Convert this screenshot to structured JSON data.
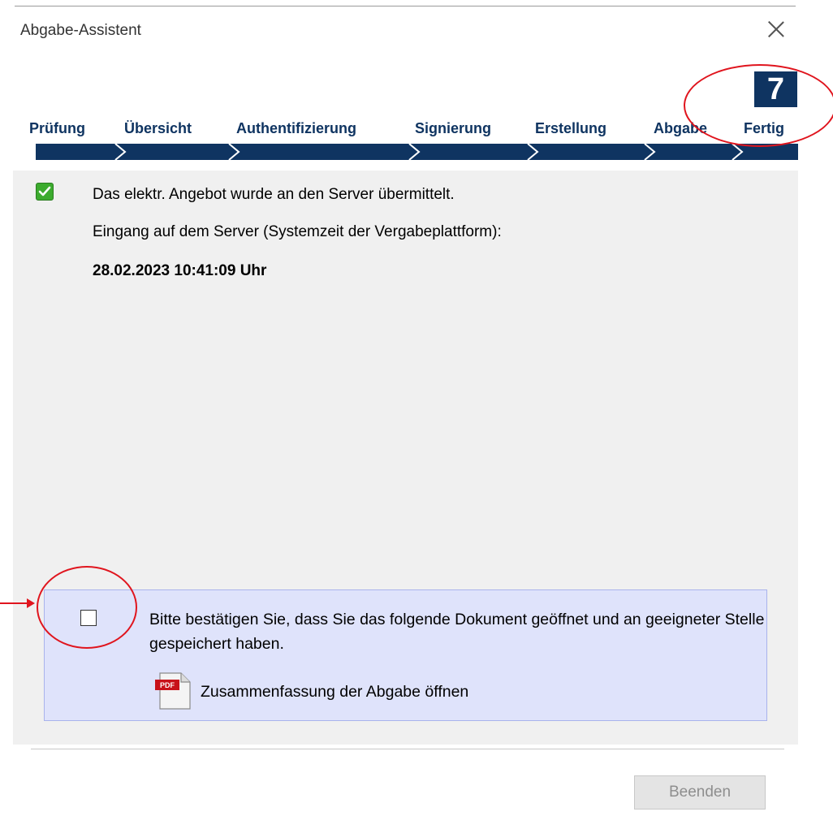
{
  "window": {
    "title": "Abgabe-Assistent"
  },
  "wizard": {
    "current_step": "7",
    "steps": [
      {
        "label": "Prüfung"
      },
      {
        "label": "Übersicht"
      },
      {
        "label": "Authentifizierung"
      },
      {
        "label": "Signierung"
      },
      {
        "label": "Erstellung"
      },
      {
        "label": "Abgabe"
      },
      {
        "label": "Fertig"
      }
    ]
  },
  "content": {
    "success_message": "Das elektr. Angebot wurde an den Server übermittelt.",
    "receipt_label": "Eingang auf dem Server (Systemzeit der Vergabeplattform):",
    "receipt_timestamp": "28.02.2023 10:41:09 Uhr"
  },
  "confirm": {
    "checked": false,
    "text": "Bitte bestätigen Sie, dass Sie das folgende Dokument geöffnet und an geeigneter Stelle gespeichert haben.",
    "pdf_badge": "PDF",
    "pdf_link_label": "Zusammenfassung der Abgabe öffnen"
  },
  "footer": {
    "finish_label": "Beenden",
    "finish_enabled": false
  },
  "colors": {
    "wizard_navy": "#0f3461",
    "panel_bg": "#f0f0f0",
    "confirm_bg": "#dfe3fb",
    "success_green": "#3cab2e",
    "annotation_red": "#e0151e"
  }
}
